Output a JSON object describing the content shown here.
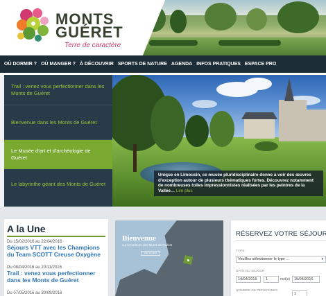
{
  "brand": {
    "name_line1": "MONTS",
    "name_line2": "GUÉRET",
    "tagline": "Terre de caractère",
    "colors": {
      "primary_dark": "#1d2d38",
      "green": "#79a92f",
      "pink": "#c23a6c",
      "link_blue": "#2f75b5"
    }
  },
  "nav": {
    "items": [
      {
        "label": "OÙ DORMIR ?"
      },
      {
        "label": "OÙ MANGER ?"
      },
      {
        "label": "À DÉCOUVRIR"
      },
      {
        "label": "SPORTS DE NATURE"
      },
      {
        "label": "AGENDA"
      },
      {
        "label": "INFOS PRATIQUES"
      },
      {
        "label": "ESPACE PRO"
      }
    ]
  },
  "slider": {
    "items": [
      {
        "label": "Trail : venez vous perfectionner dans les Monts de Guéret"
      },
      {
        "label": "Bienvenue dans les Monts de Guéret"
      },
      {
        "label": "Le Musée d'art et d'archéologie de Guéret",
        "active": true
      },
      {
        "label": "Le labyrinthe géant des Monts de Guéret"
      }
    ],
    "caption": "Unique en Limousin, ce musée pluridisciplinaire donne à voir des œuvres d'exception autour de plusieurs thématiques fortes. Découvrez notamment de nombreuses toiles impressionnistes réalisées par les peintres de la Vallée…",
    "caption_more": "Lire plus"
  },
  "news": {
    "title": "A la Une",
    "items": [
      {
        "date": "Du 15/02/2016 au 22/04/2016",
        "headline": "Séjours VTT avec les Champions du Team SCOTT Creuse Oxygène"
      },
      {
        "date": "Du 08/04/2016 au 20/11/2016",
        "headline": "Trail : venez vous perfectionner dans les Monts de Guéret"
      },
      {
        "date": "Du 07/05/2016 au 30/09/2016",
        "headline": ""
      }
    ]
  },
  "map": {
    "title": "Bienvenue",
    "subtitle": "sur le territoire des Monts de Guéret",
    "button": "voir la carte",
    "icon": "location-pin-icon"
  },
  "booking": {
    "title": "RÉSERVEZ VOTRE SÉJOUR",
    "type_label": "TYPE",
    "type_value": "Veuillez sélectionner le type ...",
    "date_label": "DATE DU SÉJOUR",
    "start_date": "14/04/2016",
    "nights": "1",
    "nights_label": "nuit(s)",
    "end_date": "15/04/2016",
    "people_label": "NOMBRE DE PERSONNES",
    "people_value": "1"
  }
}
